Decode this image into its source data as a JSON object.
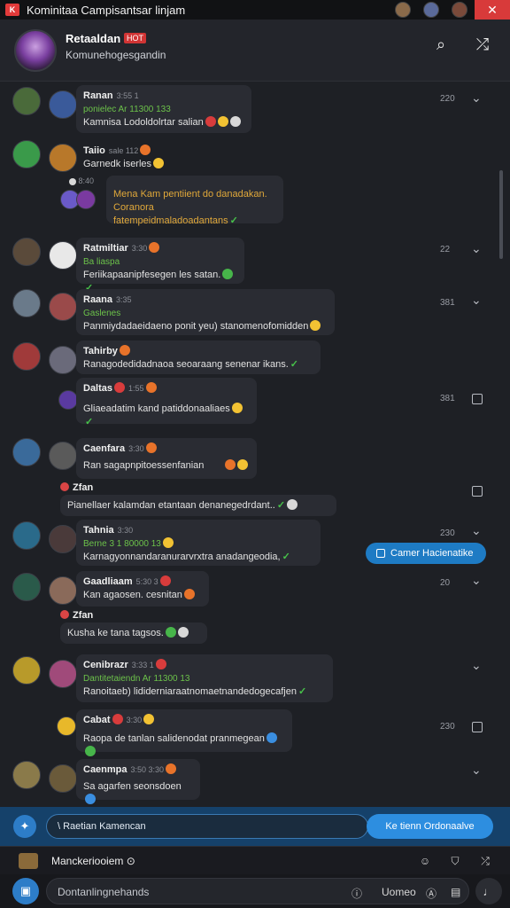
{
  "window": {
    "title": "Kominitaa Campisantsar linjam",
    "close_glyph": "✕",
    "app_icon_glyph": "K",
    "colors": {
      "accent": "#2d8ee0",
      "close": "#d83a3a",
      "bg": "#1e2025"
    }
  },
  "header": {
    "name": "Retaaldan",
    "badge": "HOT",
    "subtitle": "Komunehogesgandin",
    "icons": [
      "search-icon",
      "shuffle-icon"
    ],
    "search_glyph": "⌕",
    "shuffle_glyph": "⤮"
  },
  "messages": [
    {
      "name": "Ranan",
      "meta": "3:55 1",
      "status": "ponielec  Ar 11300 133",
      "text": "Kamnisa Lodoldolrtar salian",
      "time": "220"
    },
    {
      "name": "Taiio",
      "meta": "sale 112",
      "text": "Garnedk iserles",
      "reply_meta": "8:40",
      "reply_title": "Mena  Kam pentiient do danadakan.",
      "reply_text": "Coranora fatempeidmaladoadantans"
    },
    {
      "name": "Ratmiltiar",
      "meta": "3:30",
      "status": "Ba liaspa",
      "text": "Feriikapaanipfesegen les satan.",
      "time": "22"
    },
    {
      "name": "Raana",
      "meta": "3:35",
      "status": "Gaslenes",
      "text": "Panmiydadaeidaeno ponit yeu) stanomenofomidden",
      "time": "381"
    },
    {
      "name": "Tahirby",
      "meta": "",
      "text": "Ranagodedidadnaoa seoaraang senenar ikans.",
      "reply_title": "Daltas",
      "reply_meta": "1:55",
      "reply_text": "Gliaeadatim kand patiddonaaliaes",
      "time": "381"
    },
    {
      "name": "Caenfara",
      "meta": "3:30",
      "text": "Ran sagapnpitoessenfanian",
      "reply_title": "Zfan",
      "reply_text": "Pianellaer kalamdan  etantaan  denanegedrdant.."
    },
    {
      "name": "Tahnia",
      "meta": "3:30",
      "status": "Berne  3 1 80000 13",
      "text": "Karnagyonnandaranurarvrxtra anadangeodia,",
      "time": "230"
    },
    {
      "name": "Gaadliaam",
      "meta": "5:30 3",
      "text": "Kan agaosen. cesnitan",
      "reply_title": "Zfan",
      "reply_text": "Kusha ke tana tagsos.",
      "time": "20"
    },
    {
      "name": "Cenibrazr",
      "meta": "3:33 1",
      "status": "Dantitetaiendn  Ar 11300 13",
      "text": "Ranoitaeb) lididerniaraatnomaetnandedogecafjen",
      "time": ""
    },
    {
      "name": "Cabat",
      "meta": "3:30",
      "text": "Raopa de tanlan salidenodat  pranmegean",
      "time": "230"
    },
    {
      "name": "Caenmpa",
      "meta": "3:50 3:30",
      "text": "Sa agarfen  seonsdoen"
    }
  ],
  "hint_pill": "Camer Hacienatike",
  "action_bar": {
    "input_text": "\\ Raetian Kamencan",
    "button_label": "Ke tienn Ordonaalve"
  },
  "participant": {
    "name": "Manckeriooiem"
  },
  "composer": {
    "placeholder": "Dontanlingnehands",
    "right_label": "Uomeo"
  }
}
